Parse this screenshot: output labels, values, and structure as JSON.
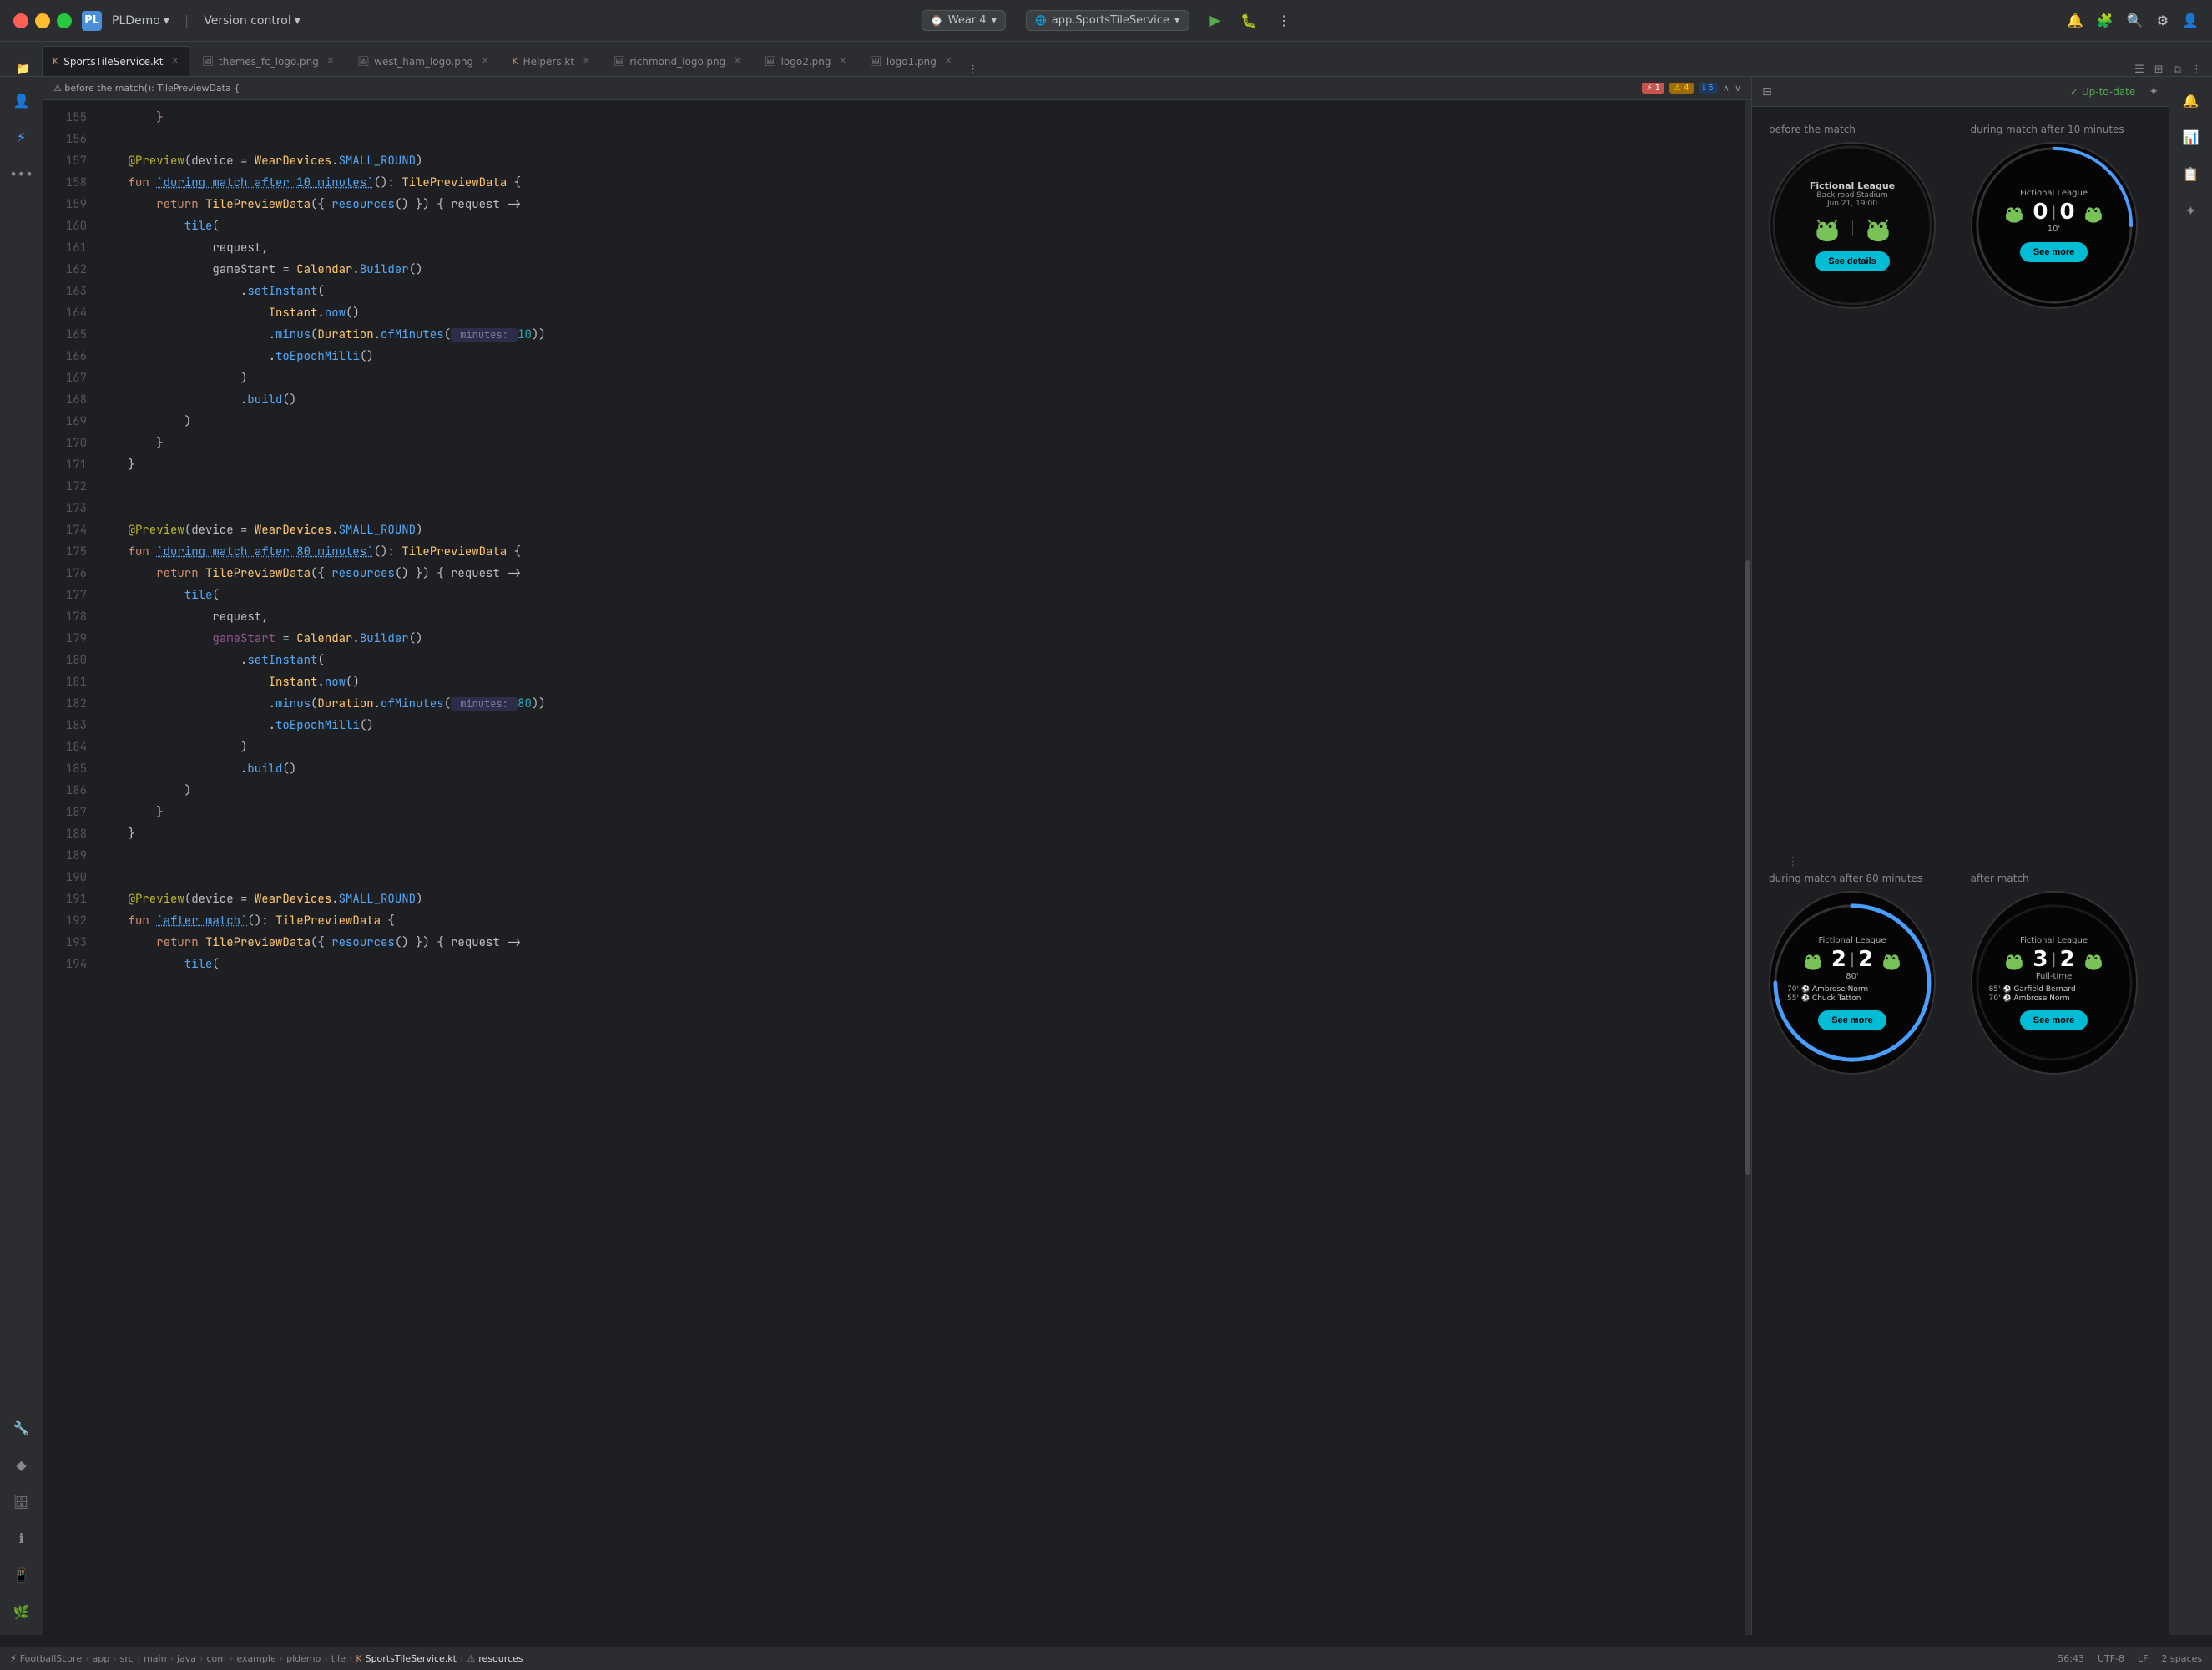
{
  "titlebar": {
    "traffic_lights": [
      "red",
      "yellow",
      "green"
    ],
    "app_logo": "PL",
    "project_name": "PLDemo",
    "vc_label": "Version control",
    "device_label": "Wear 4",
    "service_label": "app.SportsTileService",
    "run_icon": "▶",
    "debug_icon": "🐛",
    "more_icon": "⋮"
  },
  "tabs": [
    {
      "label": "SportsTileService.kt",
      "active": true,
      "icon": "K",
      "icon_color": "#cf8e6d"
    },
    {
      "label": "themes_fc_logo.png",
      "active": false,
      "icon": "🖼"
    },
    {
      "label": "west_ham_logo.png",
      "active": false,
      "icon": "🖼"
    },
    {
      "label": "Helpers.kt",
      "active": false,
      "icon": "K",
      "icon_color": "#cf8e6d"
    },
    {
      "label": "richmond_logo.png",
      "active": false,
      "icon": "🖼"
    },
    {
      "label": "logo2.png",
      "active": false,
      "icon": "🖼"
    },
    {
      "label": "logo1.png",
      "active": false,
      "icon": "🖼"
    }
  ],
  "editor": {
    "warning_counts": {
      "errors": 1,
      "warnings": 4,
      "infos": 5
    },
    "lines": [
      {
        "num": 155,
        "code": "        }",
        "indent": 2
      },
      {
        "num": 156,
        "code": "",
        "indent": 0
      },
      {
        "num": 157,
        "code": "    @Preview(device = WearDevices.SMALL_ROUND)",
        "indent": 1
      },
      {
        "num": 158,
        "code": "    fun `during match after 10 minutes`(): TilePreviewData {",
        "indent": 1
      },
      {
        "num": 159,
        "code": "        return TilePreviewData({ resources() }) { request ->",
        "indent": 2
      },
      {
        "num": 160,
        "code": "            tile(",
        "indent": 3
      },
      {
        "num": 161,
        "code": "                request,",
        "indent": 4
      },
      {
        "num": 162,
        "code": "                gameStart = Calendar.Builder()",
        "indent": 4
      },
      {
        "num": 163,
        "code": "                    .setInstant(",
        "indent": 5
      },
      {
        "num": 164,
        "code": "                        Instant.now()",
        "indent": 6
      },
      {
        "num": 165,
        "code": "                        .minus(Duration.ofMinutes( minutes: 10))",
        "indent": 6
      },
      {
        "num": 166,
        "code": "                        .toEpochMilli()",
        "indent": 6
      },
      {
        "num": 167,
        "code": "                    )",
        "indent": 5
      },
      {
        "num": 168,
        "code": "                    .build()",
        "indent": 5
      },
      {
        "num": 169,
        "code": "            )",
        "indent": 3
      },
      {
        "num": 170,
        "code": "        }",
        "indent": 2
      },
      {
        "num": 171,
        "code": "    }",
        "indent": 1
      },
      {
        "num": 172,
        "code": "",
        "indent": 0
      },
      {
        "num": 173,
        "code": "",
        "indent": 0
      },
      {
        "num": 174,
        "code": "    @Preview(device = WearDevices.SMALL_ROUND)",
        "indent": 1
      },
      {
        "num": 175,
        "code": "    fun `during match after 80 minutes`(): TilePreviewData {",
        "indent": 1
      },
      {
        "num": 176,
        "code": "        return TilePreviewData({ resources() }) { request ->",
        "indent": 2
      },
      {
        "num": 177,
        "code": "            tile(",
        "indent": 3
      },
      {
        "num": 178,
        "code": "                request,",
        "indent": 4
      },
      {
        "num": 179,
        "code": "                gameStart = Calendar.Builder()",
        "indent": 4
      },
      {
        "num": 180,
        "code": "                    .setInstant(",
        "indent": 5
      },
      {
        "num": 181,
        "code": "                        Instant.now()",
        "indent": 6
      },
      {
        "num": 182,
        "code": "                        .minus(Duration.ofMinutes( minutes: 80))",
        "indent": 6
      },
      {
        "num": 183,
        "code": "                        .toEpochMilli()",
        "indent": 6
      },
      {
        "num": 184,
        "code": "                    )",
        "indent": 5
      },
      {
        "num": 185,
        "code": "                    .build()",
        "indent": 5
      },
      {
        "num": 186,
        "code": "            )",
        "indent": 3
      },
      {
        "num": 187,
        "code": "        }",
        "indent": 2
      },
      {
        "num": 188,
        "code": "    }",
        "indent": 1
      },
      {
        "num": 189,
        "code": "",
        "indent": 0
      },
      {
        "num": 190,
        "code": "",
        "indent": 0
      },
      {
        "num": 191,
        "code": "    @Preview(device = WearDevices.SMALL_ROUND)",
        "indent": 1
      },
      {
        "num": 192,
        "code": "    fun `after match`(): TilePreviewData {",
        "indent": 1
      },
      {
        "num": 193,
        "code": "        return TilePreviewData({ resources() }) { request ->",
        "indent": 2
      },
      {
        "num": 194,
        "code": "            tile(",
        "indent": 3
      }
    ]
  },
  "preview": {
    "up_to_date_label": "Up-to-date",
    "cells": [
      {
        "label": "before the match",
        "type": "before_match",
        "league": "Fictional League",
        "venue": "Back road Stadium",
        "date": "Jun 21, 19:00",
        "button_label": "See details"
      },
      {
        "label": "during match after 10 minutes",
        "type": "during_10",
        "league": "Fictional League",
        "score_home": "0",
        "score_away": "0",
        "minute": "10'",
        "button_label": "See more"
      },
      {
        "label": "during match after 80 minutes",
        "type": "during_80",
        "league": "Fictional League",
        "score_home": "2",
        "score_away": "2",
        "minute": "80'",
        "goals": [
          {
            "time": "70'",
            "player": "Ambrose Norm"
          },
          {
            "time": "55'",
            "player": "Chuck Tatton"
          }
        ],
        "button_label": "See more"
      },
      {
        "label": "after match",
        "type": "after_match",
        "league": "Fictional League",
        "score_home": "3",
        "score_away": "2",
        "status": "Full-time",
        "goals": [
          {
            "time": "85'",
            "player": "Garfield Bernard"
          },
          {
            "time": "70'",
            "player": "Ambrose Norm"
          }
        ],
        "button_label": "See more"
      }
    ]
  },
  "statusbar": {
    "path": "FootballScore > app > src > main > java > com > example > pldemo > tile > SportsTileService.kt",
    "branch_icon": "⚠",
    "file_label": "SportsTileService.kt",
    "resources_label": "resources",
    "position": "56:43",
    "encoding": "UTF-8",
    "line_sep": "LF",
    "indent": "2 spaces"
  }
}
